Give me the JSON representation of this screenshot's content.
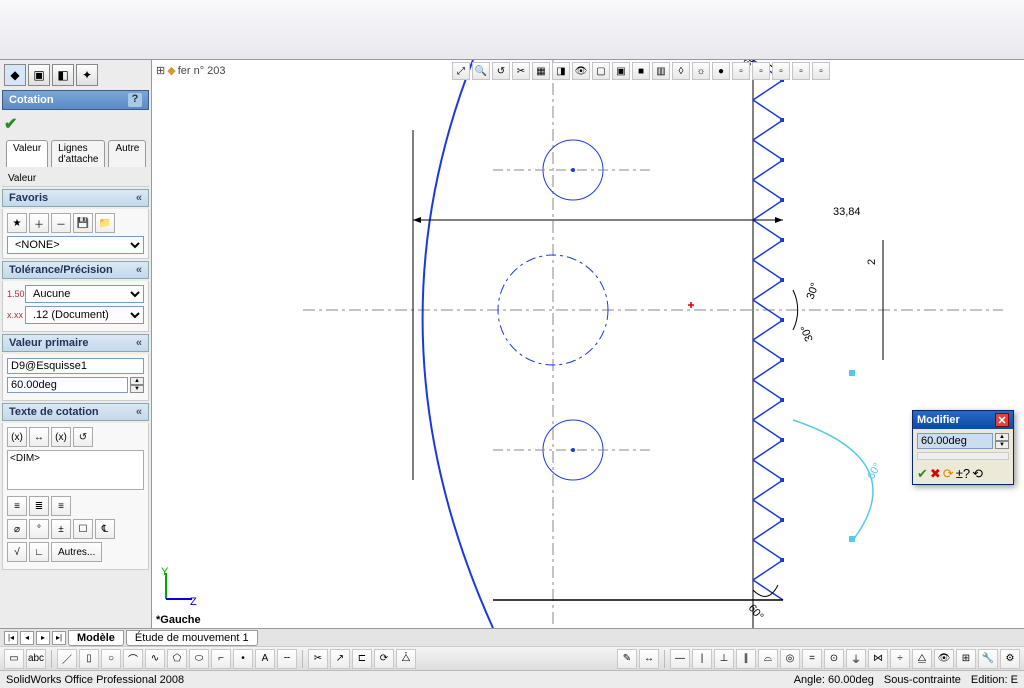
{
  "app": {
    "title": "SolidWorks Office Professional 2008"
  },
  "feature_tree": {
    "root": "fer n° 203"
  },
  "prop_panel": {
    "title": "Cotation",
    "tabs": {
      "value": "Valeur",
      "leaders": "Lignes d'attache",
      "other": "Autre"
    },
    "favoris": {
      "title": "Favoris",
      "select": "<NONE>"
    },
    "tolerance": {
      "title": "Tolérance/Précision",
      "none": "Aucune",
      "precision": ".12 (Document)"
    },
    "primary": {
      "title": "Valeur primaire",
      "name": "D9@Esquisse1",
      "value": "60.00deg"
    },
    "dimtext": {
      "title": "Texte de cotation",
      "text": "<DIM>",
      "more_btn": "Autres..."
    }
  },
  "canvas": {
    "view_label": "*Gauche",
    "axes": {
      "y": "Y",
      "z": "Z"
    },
    "dims": {
      "width": "33,84",
      "rake": "2",
      "angle_half": "30°",
      "cone": "60°"
    }
  },
  "modifier": {
    "title": "Modifier",
    "value": "60.00deg"
  },
  "bottom_tabs": {
    "model": "Modèle",
    "motion": "Étude de mouvement 1"
  },
  "status": {
    "angle": "Angle: 60.00deg",
    "constraint": "Sous-contrainte",
    "edition": "Edition: E"
  },
  "colors": {
    "sketch_blue": "#1a3ae0",
    "construction": "#888",
    "highlight": "#58c8e8"
  }
}
